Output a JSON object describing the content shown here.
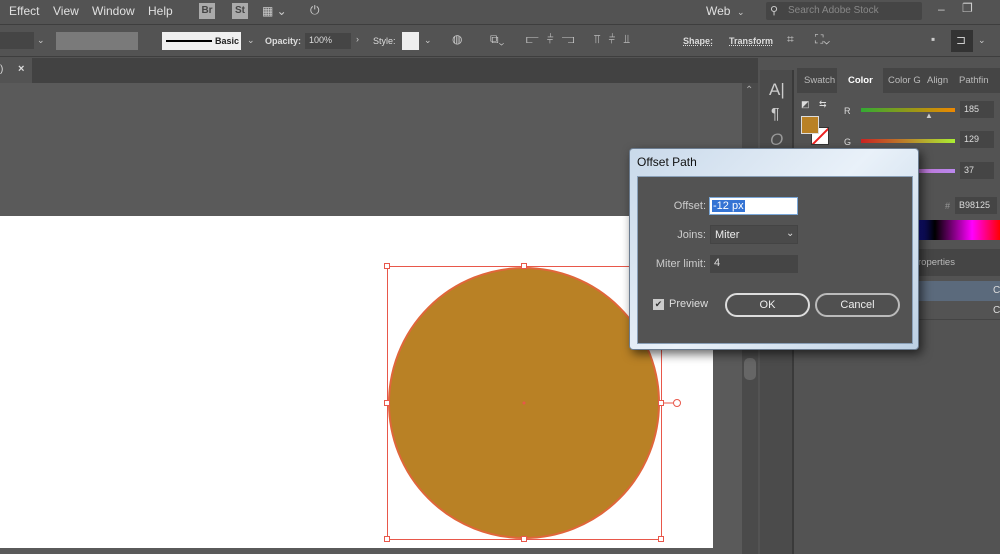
{
  "menu": {
    "items": [
      "Effect",
      "View",
      "Window",
      "Help"
    ],
    "bridge": "Br",
    "stock": "St",
    "workspace": "Web",
    "search_placeholder": "Search Adobe Stock"
  },
  "control": {
    "stroke_style": "Basic",
    "opacity_label": "Opacity:",
    "opacity_value": "100%",
    "style_label": "Style:",
    "shape_label": "Shape:",
    "transform_label": "Transform"
  },
  "tab": {
    "close": "×",
    "title_tail": ")"
  },
  "panel": {
    "tabs": [
      "Swatch",
      "Color",
      "Color G",
      "Align",
      "Pathfin"
    ],
    "active_tab": "Color",
    "r_label": "R",
    "g_label": "G",
    "r": "185",
    "g": "129",
    "b": "37",
    "hex_label": "#",
    "hex": "B98125",
    "properties_tab": "roperties",
    "layer_vis": [
      "C",
      "C"
    ]
  },
  "colors": {
    "fill": "#b98125",
    "selection": "#e8574a"
  },
  "dialog": {
    "title": "Offset Path",
    "offset_label": "Offset:",
    "offset_value": "-12 px",
    "joins_label": "Joins:",
    "joins_value": "Miter",
    "miter_label": "Miter limit:",
    "miter_value": "4",
    "preview_label": "Preview",
    "preview_checked": true,
    "ok": "OK",
    "cancel": "Cancel"
  }
}
